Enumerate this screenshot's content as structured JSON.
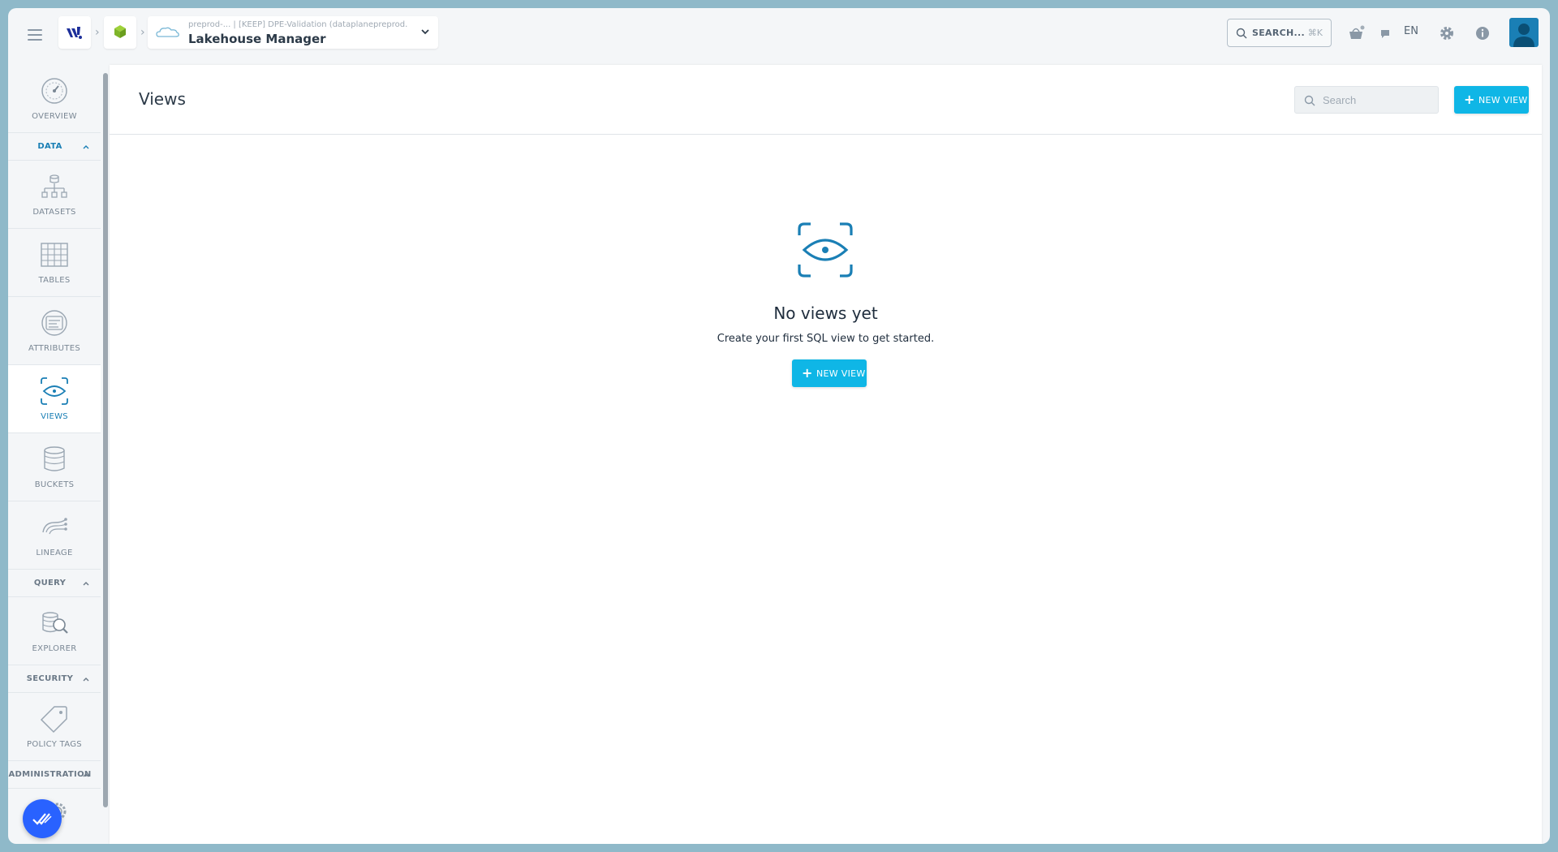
{
  "topbar": {
    "project_subtitle": "preprod-...  | [KEEP] DPE-Validation (dataplanepreprod...)",
    "project_title": "Lakehouse Manager",
    "search_label": "SEARCH...",
    "search_shortcut": "⌘K",
    "language": "EN"
  },
  "sidebar": {
    "overview": "OVERVIEW",
    "section_data": "DATA",
    "datasets": "DATASETS",
    "tables": "TABLES",
    "attributes": "ATTRIBUTES",
    "views": "VIEWS",
    "buckets": "BUCKETS",
    "lineage": "LINEAGE",
    "section_query": "QUERY",
    "explorer": "EXPLORER",
    "section_security": "SECURITY",
    "policy_tags": "POLICY TAGS",
    "section_administration": "ADMINISTRATION",
    "active_item": "views"
  },
  "main": {
    "title": "Views",
    "search_placeholder": "Search",
    "new_view_label": "NEW VIEW",
    "empty_title": "No views yet",
    "empty_subtitle": "Create your first SQL view to get started.",
    "empty_button_label": "NEW VIEW"
  },
  "colors": {
    "accent": "#0fb6e6",
    "active_nav": "#1a7fb5",
    "fab": "#2962ff"
  }
}
